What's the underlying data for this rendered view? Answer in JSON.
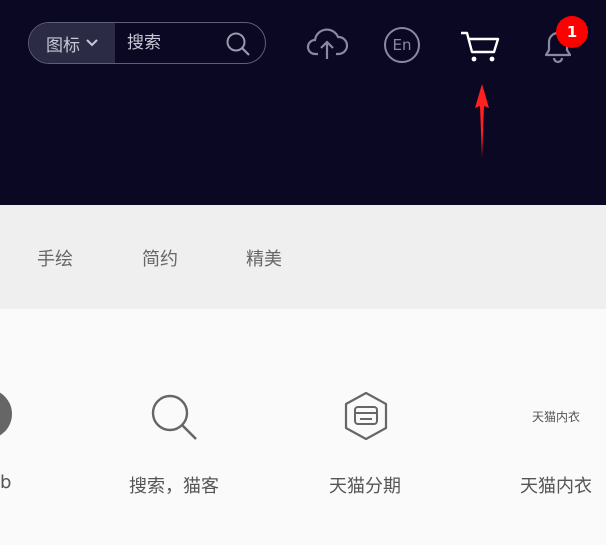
{
  "header": {
    "search": {
      "type_label": "图标",
      "placeholder": "搜索"
    },
    "lang_label": "En",
    "notification_count": "1",
    "colors": {
      "background": "#0a0822",
      "badge": "#ff0000",
      "arrow": "#ff2020"
    }
  },
  "tabs": [
    "手绘",
    "简约",
    "精美"
  ],
  "features": {
    "partial_label": "b",
    "items": [
      {
        "label": "搜索，猫客",
        "icon": "search-icon"
      },
      {
        "label": "天猫分期",
        "icon": "card-hexagon-icon"
      },
      {
        "label": "天猫内衣",
        "icon_text": "天猫内衣"
      }
    ]
  }
}
